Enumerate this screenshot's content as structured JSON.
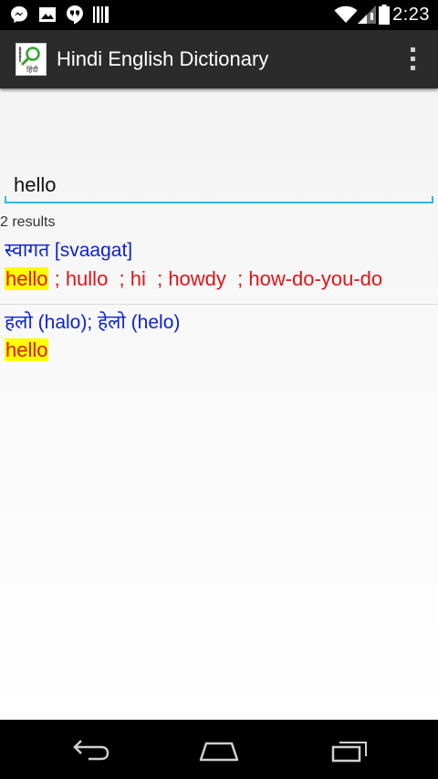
{
  "status_bar": {
    "time": "2:23",
    "left_icons": [
      "messenger-icon",
      "image-icon",
      "hangouts-icon",
      "barcode-icon"
    ],
    "right_icons": [
      "wifi-icon",
      "signal-icon",
      "battery-icon"
    ]
  },
  "action_bar": {
    "title": "Hindi English Dictionary",
    "app_icon_caption": "हिंदी"
  },
  "search": {
    "value": "hello"
  },
  "results": {
    "count_text": "2 results",
    "items": [
      {
        "hindi": "स्वागत [svaagat]",
        "highlight": "hello",
        "rest": " ; hullo  ; hi  ; howdy  ; how-do-you-do"
      },
      {
        "hindi": "हलो (halo); हेलो (helo)",
        "highlight": "hello",
        "rest": ""
      }
    ]
  },
  "colors": {
    "action_bar": "#2b2b2b",
    "hindi_text": "#0a1fd8",
    "english_text": "#e0141a",
    "highlight": "#ffff00",
    "search_underline": "#33b5e5"
  },
  "nav_bar": {
    "buttons": [
      "back-icon",
      "home-icon",
      "recent-apps-icon"
    ]
  }
}
